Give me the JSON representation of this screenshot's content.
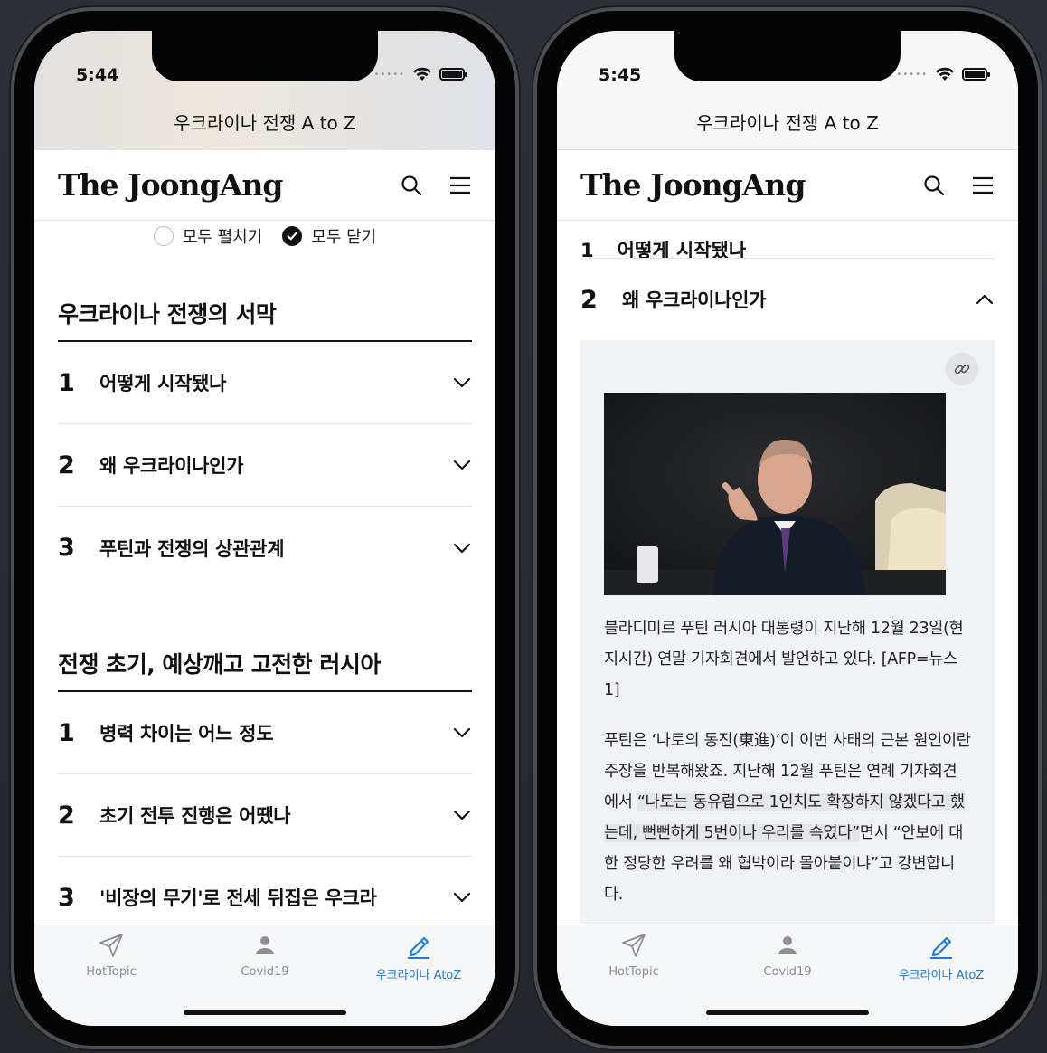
{
  "colors": {
    "accent": "#1877f2",
    "text": "#111111",
    "article_bg": "#f1f2f6"
  },
  "left": {
    "status_time": "5:44",
    "topbar_title": "우크라이나 전쟁 A to Z",
    "brand": "The JoongAng",
    "toggles": {
      "expand_all": "모두 펼치기",
      "collapse_all": "모두 닫기",
      "selected": "collapse_all"
    },
    "sections": [
      {
        "title": "우크라이나 전쟁의 서막",
        "items": [
          {
            "num": "1",
            "label": "어떻게 시작됐나"
          },
          {
            "num": "2",
            "label": "왜 우크라이나인가"
          },
          {
            "num": "3",
            "label": "푸틴과 전쟁의 상관관계"
          }
        ]
      },
      {
        "title": "전쟁 초기, 예상깨고 고전한 러시아",
        "items": [
          {
            "num": "1",
            "label": "병력 차이는 어느 정도"
          },
          {
            "num": "2",
            "label": "초기 전투 진행은 어땠나"
          },
          {
            "num": "3",
            "label": "'비장의 무기'로 전세 뒤집은 우크라"
          }
        ]
      }
    ]
  },
  "right": {
    "status_time": "5:45",
    "topbar_title": "우크라이나 전쟁 A to Z",
    "brand": "The JoongAng",
    "cut_item": {
      "num": "1",
      "label": "어떻게 시작됐나"
    },
    "open_item": {
      "num": "2",
      "label": "왜 우크라이나인가"
    },
    "caption": "블라디미르 푸틴 러시아 대통령이 지난해 12월 23일(현지시간) 연말 기자회견에서 발언하고 있다. [AFP=뉴스1]",
    "body": {
      "part1": "푸틴은 ‘나토의 동진(東進)’이 이번 사태의 근본 원인이란 주장을 반복해왔죠. 지난해 12월 푸틴은 연례 기자회견에서 ",
      "highlight": "“나토는 동유럽으로 1인치도 확장하지 않겠다고 했는데, 뻔뻔하게 5번이나 우리를 속였다”",
      "part2": "면서 “안보에 대한 정당한 우려를 왜 협박이라 몰아붙이냐”고 강변합니다."
    }
  },
  "tabs": [
    {
      "label": "HotTopic",
      "icon": "paper-plane-icon"
    },
    {
      "label": "Covid19",
      "icon": "person-icon"
    },
    {
      "label": "우크라이나 AtoZ",
      "icon": "pencil-icon",
      "active": true
    }
  ]
}
